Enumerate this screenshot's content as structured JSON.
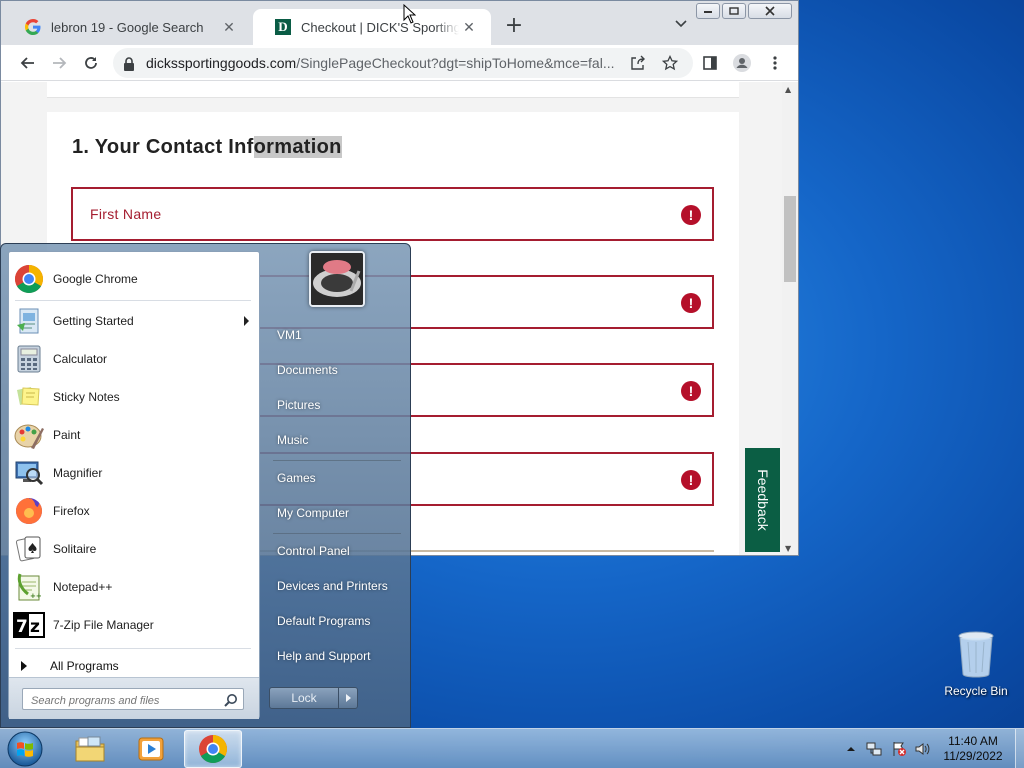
{
  "browser": {
    "tabs": [
      {
        "title": "lebron 19 - Google Search",
        "favicon": "google-icon",
        "close": "✕"
      },
      {
        "title": "Checkout | DICK'S Sporting Goods",
        "favicon": "dicks-icon",
        "favicon_letter": "D",
        "close": "✕"
      }
    ],
    "new_tab": "+",
    "url": {
      "host": "dickssportinggoods.com",
      "path": "/SinglePageCheckout?dgt=shipToHome&mce=fal..."
    }
  },
  "checkout": {
    "section_title_a": "1. Your Contact Inf",
    "section_title_b": "ormation",
    "fields": [
      {
        "label": "First Name",
        "error_icon": "!"
      },
      {
        "label": "",
        "error_icon": "!"
      },
      {
        "label": "",
        "error_icon": "!"
      },
      {
        "label": "",
        "error_icon": "!"
      }
    ],
    "feedback": "Feedback",
    "error_color": "#a51d30",
    "brand_color": "#0b5e44"
  },
  "start_menu": {
    "pinned": [
      {
        "label": "Google Chrome",
        "icon": "chrome-icon"
      },
      {
        "label": "Getting Started",
        "icon": "getting-started-icon",
        "submenu": true
      },
      {
        "label": "Calculator",
        "icon": "calculator-icon"
      },
      {
        "label": "Sticky Notes",
        "icon": "sticky-notes-icon"
      },
      {
        "label": "Paint",
        "icon": "paint-icon"
      },
      {
        "label": "Magnifier",
        "icon": "magnifier-icon"
      },
      {
        "label": "Firefox",
        "icon": "firefox-icon"
      },
      {
        "label": "Solitaire",
        "icon": "solitaire-icon"
      },
      {
        "label": "Notepad++",
        "icon": "notepadpp-icon"
      },
      {
        "label": "7-Zip File Manager",
        "icon": "7zip-icon"
      }
    ],
    "all_programs": "All Programs",
    "search_placeholder": "Search programs and files",
    "right_items": [
      "VM1",
      "Documents",
      "Pictures",
      "Music",
      "Games",
      "My Computer",
      "Control Panel",
      "Devices and Printers",
      "Default Programs",
      "Help and Support"
    ],
    "lock_label": "Lock"
  },
  "desktop": {
    "recycle_bin": "Recycle Bin"
  },
  "taskbar": {
    "time": "11:40 AM",
    "date": "11/29/2022"
  }
}
